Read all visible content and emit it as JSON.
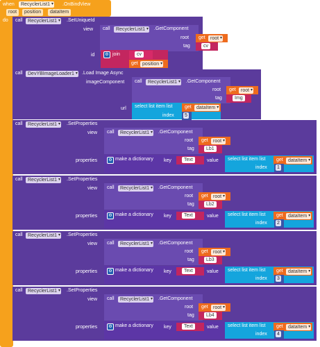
{
  "event": {
    "when": "when",
    "component": "RecyclerList1",
    "name": ".OnBindView",
    "params": [
      "root",
      "position",
      "dataItem"
    ],
    "do": "do"
  },
  "labels": {
    "call": "call",
    "view": "view",
    "id": "id",
    "root": "root",
    "tag": "tag",
    "get": "get",
    "join": "join",
    "imageComponent": "imageComponent",
    "url": "url",
    "select_list_item": "select list item  list",
    "index": "index",
    "properties": "properties",
    "make_dict": "make a dictionary",
    "key": "key",
    "value": "value"
  },
  "blocks": {
    "component": "RecyclerList1",
    "set_unique_id": ".SetUniqueId",
    "get_component": ".GetComponent",
    "loader": "DevYBImageLoader1",
    "load_image": ".Load Image Async",
    "set_properties": ".SetProperties",
    "var_root": "root",
    "var_position": "position",
    "var_dataitem": "dataItem",
    "cv": "cv",
    "img": "Img",
    "text_key": "Text"
  },
  "rows": [
    {
      "tag": "Lb1",
      "index": "1"
    },
    {
      "tag": "Lb2",
      "index": "2"
    },
    {
      "tag": "Lb3",
      "index": "3"
    },
    {
      "tag": "Lb4",
      "index": "4"
    }
  ],
  "image_index": "5",
  "colors": {
    "event": "#f6a11c",
    "component_call": "#5b3b9c",
    "list": "#14a5dd",
    "variable_get": "#ee6b1e",
    "text": "#c3265f",
    "math": "#3a55a8"
  }
}
